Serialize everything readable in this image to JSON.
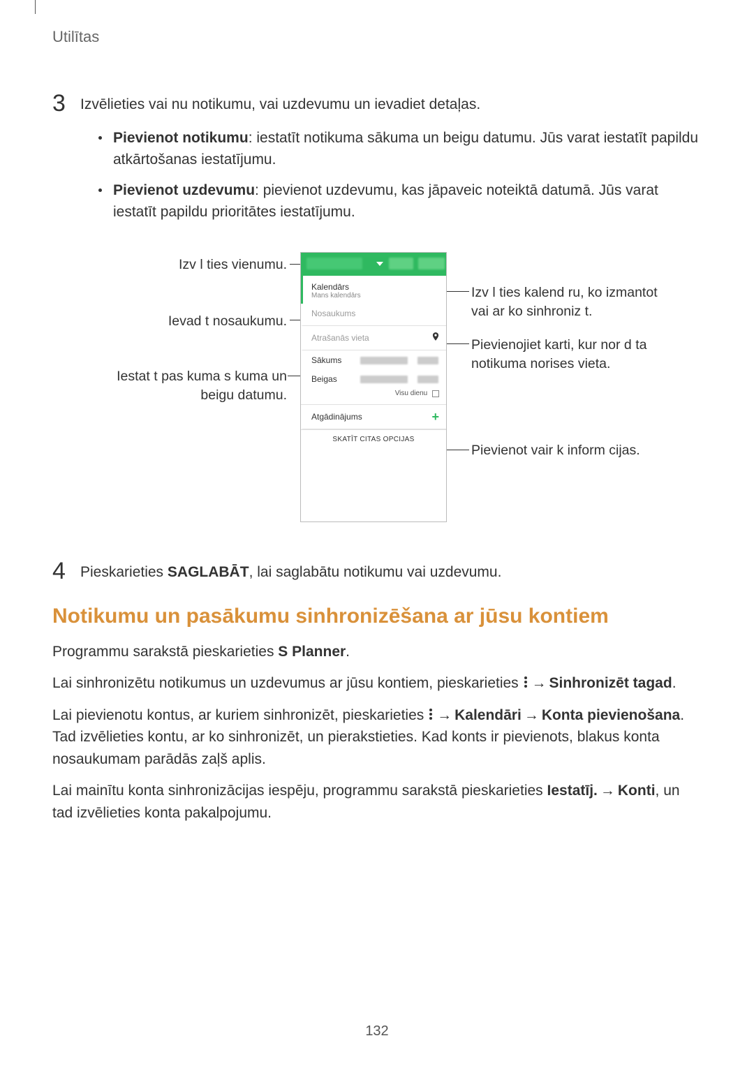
{
  "header": "Utilītas",
  "step3_num": "3",
  "step3_intro": "Izvēlieties vai nu notikumu, vai uzdevumu un ievadiet detaļas.",
  "bullet1_bold": "Pievienot notikumu",
  "bullet1_text": ": iestatīt notikuma sākuma un beigu datumu. Jūs varat iestatīt papildu atkārtošanas iestatījumu.",
  "bullet2_bold": "Pievienot uzdevumu",
  "bullet2_text": ": pievienot uzdevumu, kas jāpaveic noteiktā datumā. Jūs varat iestatīt papildu prioritātes iestatījumu.",
  "callouts": {
    "select_item": "Izv l ties vienumu.",
    "enter_name": "Ievad t nosaukumu.",
    "set_dates_1": "Iestat t   pas kuma s kuma un",
    "set_dates_2": "beigu datumu.",
    "select_calendar_1": "Izv l ties kalend ru, ko izmantot",
    "select_calendar_2": "vai ar ko sinhroniz t.",
    "attach_map_1": "Pievienojiet karti, kur  nor d ta",
    "attach_map_2": "notikuma norises vieta.",
    "more_info": "Pievienot vair k inform cijas."
  },
  "mock": {
    "cal_title": "Kalendārs",
    "cal_sub": "Mans kalendārs",
    "name": "Nosaukums",
    "location": "Atrašanās vieta",
    "start": "Sākums",
    "end": "Beigas",
    "allday": "Visu dienu",
    "reminder": "Atgādinājums",
    "more": "SKATĪT CITAS OPCIJAS"
  },
  "step4_num": "4",
  "step4_pre": "Pieskarieties ",
  "step4_bold": "SAGLABĀT",
  "step4_post": ", lai saglabātu notikumu vai uzdevumu.",
  "section_title": "Notikumu un pasākumu sinhronizēšana ar jūsu kontiem",
  "p1_pre": "Programmu sarakstā pieskarieties ",
  "p1_bold": "S Planner",
  "p1_post": ".",
  "p2_pre": "Lai sinhronizētu notikumus un uzdevumus ar jūsu kontiem, pieskarieties ",
  "p2_bold": "Sinhronizēt tagad",
  "p2_post": ".",
  "p3_pre": "Lai pievienotu kontus, ar kuriem sinhronizēt, pieskarieties ",
  "p3_b1": "Kalendāri",
  "p3_b2": "Konta pievienošana",
  "p3_post": ". Tad izvēlieties kontu, ar ko sinhronizēt, un pierakstieties. Kad konts ir pievienots, blakus konta nosaukumam parādās zaļš aplis.",
  "p4_pre": "Lai mainītu konta sinhronizācijas iespēju, programmu sarakstā pieskarieties ",
  "p4_b1": "Iestatīj.",
  "p4_b2": "Konti",
  "p4_post": ", un tad izvēlieties konta pakalpojumu.",
  "page_number": "132"
}
